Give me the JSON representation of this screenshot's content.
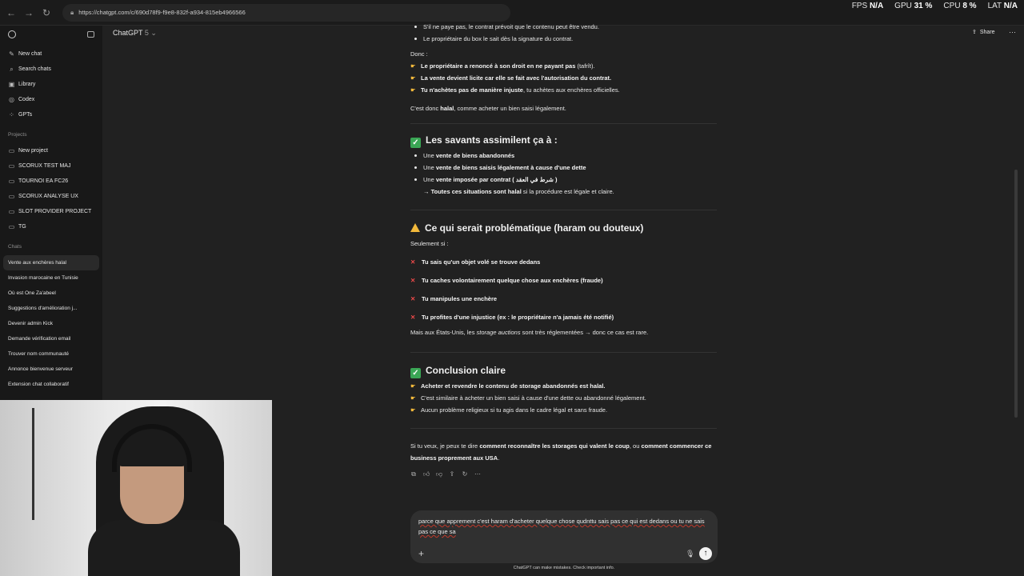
{
  "browser": {
    "url": "https://chatgpt.com/c/690d78f9-f9e8-832f-a934-815eb4966566",
    "overlay": {
      "fps_label": "FPS",
      "fps_value": "N/A",
      "gpu_label": "GPU",
      "gpu_value": "31 %",
      "cpu_label": "CPU",
      "cpu_value": "8 %",
      "lat_label": "LAT",
      "lat_value": "N/A"
    }
  },
  "sidebar": {
    "nav": [
      {
        "label": "New chat",
        "icon": "edit-icon"
      },
      {
        "label": "Search chats",
        "icon": "search-icon"
      },
      {
        "label": "Library",
        "icon": "library-icon"
      },
      {
        "label": "Codex",
        "icon": "codex-icon"
      },
      {
        "label": "GPTs",
        "icon": "grid-icon"
      }
    ],
    "projects_title": "Projects",
    "projects": [
      "New project",
      "SCORUX TEST MAJ",
      "TOURNOI EA FC26",
      "SCORUX ANALYSE UX",
      "SLOT PROVIDER PROJECT",
      "TG"
    ],
    "chats_title": "Chats",
    "chats": [
      "Vente aux enchères halal",
      "Invasion marocaine en Tunisie",
      "Où est One Za'abeel",
      "Suggestions d'amélioration j...",
      "Devenir admin Kick",
      "Demande vérification email",
      "Trouver nom communauté",
      "Annonce bienvenue serveur",
      "Extension chat collaboratif"
    ]
  },
  "header": {
    "model": "ChatGPT",
    "model_version": "5",
    "share": "Share"
  },
  "message": {
    "top_bullets": [
      "S'il ne paye pas, le contrat prévoit que le contenu peut être vendu.",
      "Le propriétaire du box le sait dès la signature du contrat."
    ],
    "donc": "Donc :",
    "donc_points": [
      {
        "bold": "Le propriétaire a renoncé à son droit en ne payant pas",
        "rest": " (tafrît)."
      },
      {
        "bold": "La vente devient licite car elle se fait avec l'autorisation du contrat.",
        "rest": ""
      },
      {
        "bold": "Tu n'achètes pas de manière injuste",
        "rest": ", tu achètes aux enchères officielles."
      }
    ],
    "halal_pre": "C'est donc ",
    "halal_bold": "halal",
    "halal_post": ", comme acheter un bien saisi légalement.",
    "section1_title": "Les savants assimilent ça à :",
    "section1_items": [
      {
        "pre": "Une ",
        "bold": "vente de biens abandonnés",
        "post": ""
      },
      {
        "pre": "Une ",
        "bold": "vente de biens saisis légalement à cause d'une dette",
        "post": ""
      },
      {
        "pre": "Une ",
        "bold": "vente imposée par contrat ( شرط في العقد )",
        "post": ""
      }
    ],
    "section1_arrow_bold": "→ Toutes ces situations sont halal",
    "section1_arrow_rest": " si la procédure est légale et claire.",
    "section2_title": "Ce qui serait problématique (haram ou douteux)",
    "section2_intro": "Seulement si :",
    "section2_items": [
      "Tu sais qu'un objet volé se trouve dedans",
      "Tu caches volontairement quelque chose aux enchères (fraude)",
      "Tu manipules une enchère",
      "Tu profites d'une injustice (ex : le propriétaire n'a jamais été notifié)"
    ],
    "section2_outro_pre": "Mais aux États-Unis, les ",
    "section2_outro_italic": "storage auctions",
    "section2_outro_post": " sont très réglementées → donc ce cas est rare.",
    "section3_title": "Conclusion claire",
    "section3_items": [
      {
        "bold": "Acheter et revendre le contenu de storage abandonnés est halal.",
        "rest": ""
      },
      {
        "bold": "",
        "rest": "C'est similaire à acheter un bien saisi à cause d'une dette ou abandonné légalement."
      },
      {
        "bold": "",
        "rest": "Aucun problème religieux si tu agis dans le cadre légal et sans fraude."
      }
    ],
    "closing_pre": "Si tu veux, je peux te dire ",
    "closing_bold1": "comment reconnaître les storages qui valent le coup",
    "closing_mid": ", ou ",
    "closing_bold2": "comment commencer ce business proprement aux USA",
    "closing_post": "."
  },
  "composer": {
    "text": "parce que apprement c'est haram d'acheter quelque chose qudnttu sais pas ce qui est dedans ou tu ne sais pas ce que sa",
    "disclaimer": "ChatGPT can make mistakes. Check important info."
  },
  "colors": {
    "accent_check": "#3aa655",
    "warn": "#f2b93b",
    "cross": "#f04a4a",
    "bg": "#212121",
    "sidebar": "#181818"
  }
}
